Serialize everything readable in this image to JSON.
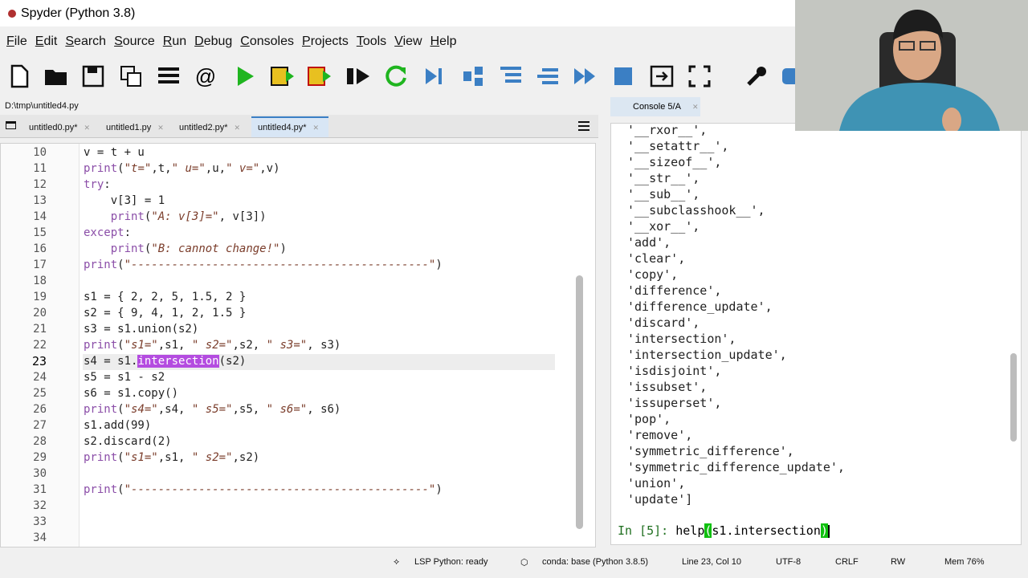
{
  "window": {
    "title": "Spyder (Python 3.8)"
  },
  "menu": [
    "File",
    "Edit",
    "Search",
    "Source",
    "Run",
    "Debug",
    "Consoles",
    "Projects",
    "Tools",
    "View",
    "Help"
  ],
  "toolbar_icons": [
    "new-file-icon",
    "open-folder-icon",
    "save-icon",
    "save-all-icon",
    "list-icon",
    "at-icon",
    "run-icon",
    "run-cell-icon",
    "run-cell-advance-icon",
    "run-selection-icon",
    "rerun-icon",
    "debug-icon",
    "step-icon",
    "step-into-icon",
    "step-return-icon",
    "continue-icon",
    "stop-icon",
    "maximize-pane-icon",
    "fullscreen-icon",
    "wrench-icon",
    "python-icon"
  ],
  "path": "D:\\tmp\\untitled4.py",
  "tabs": [
    {
      "label": "untitled0.py*"
    },
    {
      "label": "untitled1.py"
    },
    {
      "label": "untitled2.py*"
    },
    {
      "label": "untitled4.py*"
    }
  ],
  "editor": {
    "line_numbers": [
      "10",
      "11",
      "12",
      "13",
      "14",
      "15",
      "16",
      "17",
      "18",
      "19",
      "20",
      "21",
      "22",
      "23",
      "24",
      "25",
      "26",
      "27",
      "28",
      "29",
      "30",
      "31",
      "32",
      "33",
      "34"
    ],
    "current_line": "23"
  },
  "console": {
    "tab": "Console 5/A",
    "lines": [
      "'__rxor__',",
      "'__setattr__',",
      "'__sizeof__',",
      "'__str__',",
      "'__sub__',",
      "'__subclasshook__',",
      "'__xor__',",
      "'add',",
      "'clear',",
      "'copy',",
      "'difference',",
      "'difference_update',",
      "'discard',",
      "'intersection',",
      "'intersection_update',",
      "'isdisjoint',",
      "'issubset',",
      "'issuperset',",
      "'pop',",
      "'remove',",
      "'symmetric_difference',",
      "'symmetric_difference_update',",
      "'union',",
      "'update']"
    ],
    "prompt_label": "In [5]:",
    "prompt_input_a": " help",
    "prompt_input_b": "(",
    "prompt_input_c": "s1.intersection",
    "prompt_input_d": ")"
  },
  "status": {
    "lsp": "LSP Python: ready",
    "conda": "conda: base (Python 3.8.5)",
    "position": "Line 23, Col 10",
    "encoding": "UTF-8",
    "eol": "CRLF",
    "mode": "RW",
    "mem": "Mem 76%"
  }
}
